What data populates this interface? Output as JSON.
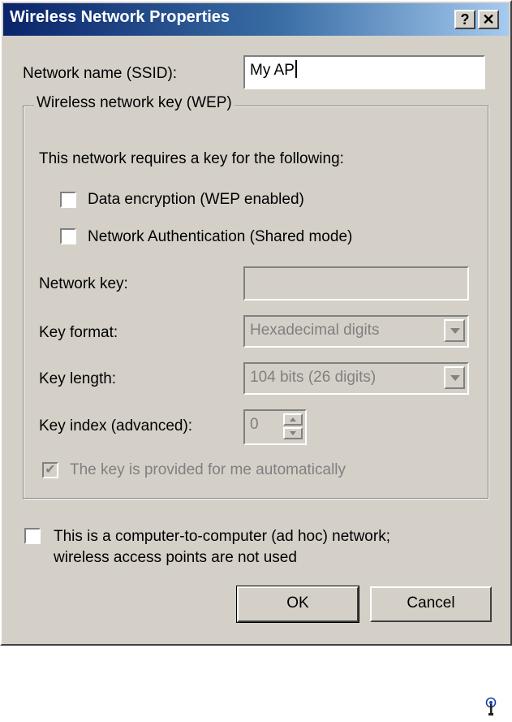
{
  "window": {
    "title": "Wireless Network Properties",
    "help_button": "?",
    "close_button": "✕"
  },
  "ssid": {
    "label": "Network name (SSID):",
    "value": "My AP"
  },
  "wep_group": {
    "legend": "Wireless network key (WEP)",
    "intro": "This network requires a key for the following:",
    "data_encryption_label": "Data encryption (WEP enabled)",
    "data_encryption_checked": false,
    "network_auth_label": "Network Authentication (Shared mode)",
    "network_auth_checked": false,
    "network_key_label": "Network key:",
    "network_key_value": "",
    "key_format_label": "Key format:",
    "key_format_value": "Hexadecimal digits",
    "key_length_label": "Key length:",
    "key_length_value": "104 bits (26 digits)",
    "key_index_label": "Key index (advanced):",
    "key_index_value": "0",
    "auto_key_label": "The key is provided for me automatically",
    "auto_key_checked": true
  },
  "adhoc": {
    "label_line1": "This is a computer-to-computer (ad hoc) network;",
    "label_line2": "wireless access points are not used",
    "checked": false
  },
  "buttons": {
    "ok": "OK",
    "cancel": "Cancel"
  },
  "icons": {
    "tray": "wireless-antenna-icon"
  }
}
